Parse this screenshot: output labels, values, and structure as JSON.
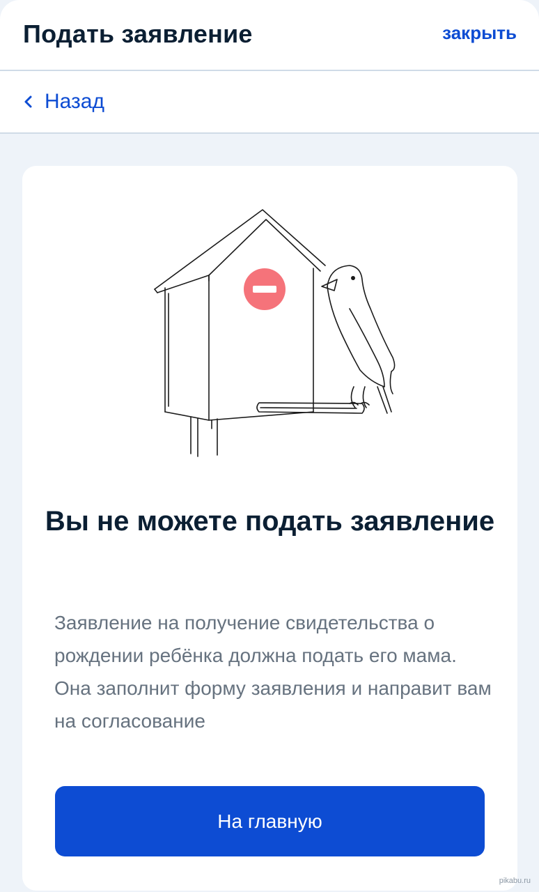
{
  "header": {
    "title": "Подать заявление",
    "close_label": "закрыть"
  },
  "nav": {
    "back_label": "Назад"
  },
  "card": {
    "heading": "Вы не можете подать заявление",
    "description": "Заявление на получение свидетельства о рождении ребёнка должна подать его мама. Она заполнит форму заявления и направит вам на согласование",
    "button_label": "На главную"
  },
  "watermark": "pikabu.ru",
  "colors": {
    "accent": "#0d4cd3",
    "title": "#0b1f33",
    "text_secondary": "#66727f",
    "stop_sign": "#f5737a"
  }
}
